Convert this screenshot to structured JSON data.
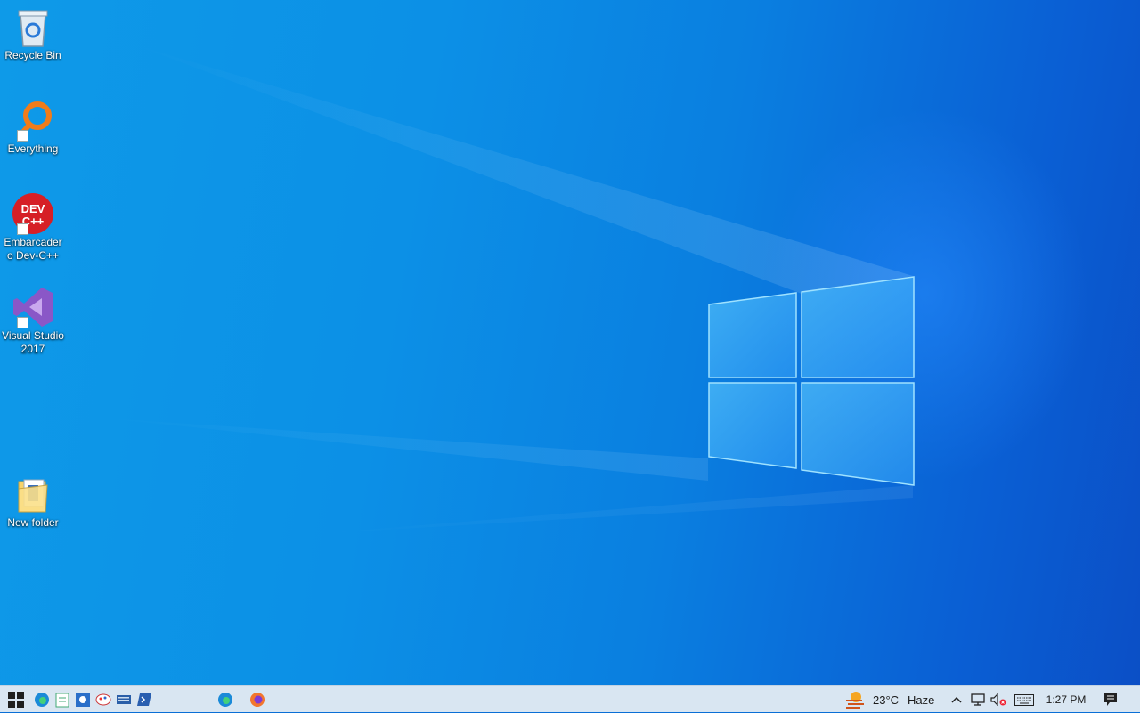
{
  "desktop": {
    "icons": [
      {
        "name": "recycle-bin",
        "label": "Recycle Bin"
      },
      {
        "name": "everything",
        "label": "Everything"
      },
      {
        "name": "embarcadero-devcpp",
        "label": "Embarcadero Dev-C++",
        "icon_text": "DEV C++"
      },
      {
        "name": "visual-studio-2017",
        "label": "Visual Studio 2017"
      },
      {
        "name": "new-folder",
        "label": "New folder"
      }
    ]
  },
  "taskbar": {
    "pinned": [
      "start-icon",
      "edge-icon",
      "notepad-icon",
      "control-panel-icon",
      "paint-icon",
      "keyboard-app-icon",
      "powershell-icon",
      "edge-icon",
      "firefox-icon"
    ],
    "weather": {
      "temperature": "23°C",
      "condition": "Haze"
    },
    "tray": [
      "chevron-up-icon",
      "network-icon",
      "volume-muted-icon",
      "touch-keyboard-icon"
    ],
    "clock": "1:27 PM"
  },
  "colors": {
    "taskbar": "#d9e6f2",
    "wallpaper_accent": "#0a78de"
  }
}
